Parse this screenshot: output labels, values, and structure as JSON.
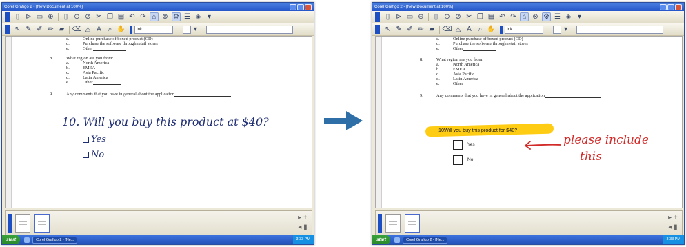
{
  "window_title": "Corel Grafigo 2 - [New Document  at 100%]",
  "toolbar_icons_top": [
    "new-doc-icon",
    "open-icon",
    "save-icon",
    "import-icon",
    "page-icon",
    "rotate-icon",
    "annotate-icon",
    "cut-icon",
    "copy-icon",
    "paste-icon",
    "undo-icon",
    "redo-icon",
    "recognize-icon",
    "link-icon",
    "settings-icon",
    "layers-icon",
    "properties-icon",
    "dropdown-icon"
  ],
  "toolbar_icons_bottom": [
    "select-icon",
    "pen-icon",
    "pen-dark-icon",
    "marker-icon",
    "highlighter-icon",
    "eraser-icon",
    "shape-icon",
    "text-icon",
    "zoom-icon",
    "pan-icon"
  ],
  "toolbar_field": "Ink",
  "document": {
    "lines_c": "c.",
    "lines_c_text": "Online purchase of boxed product (CD)",
    "lines_d": "d.",
    "lines_d_text": "Purchase the software through retail stores",
    "lines_e": "e.",
    "lines_e_text": "Other",
    "q8_num": "8.",
    "q8_text": "What region are you from:",
    "q8_a": "a.",
    "q8_a_text": "North America",
    "q8_b": "b.",
    "q8_b_text": "EMEA",
    "q8_c": "c.",
    "q8_c_text": "Asia Pacific",
    "q8_d": "d.",
    "q8_d_text": "Latin America",
    "q8_e": "e.",
    "q8_e_text": "Other",
    "q9_num": "9.",
    "q9_text": "Any comments that you have in general about the application"
  },
  "left_ink": {
    "question": "10. Will you buy this product at $40?",
    "option_yes": "Yes",
    "option_no": "No"
  },
  "right_typed": {
    "number": "10.",
    "question": "Will you buy this product for $40?",
    "option_yes": "Yes",
    "option_no": "No",
    "note_line1": "please include",
    "note_line2": "this"
  },
  "taskbar": {
    "start": "start",
    "task": "Corel Grafigo 2 - [Ne...",
    "clock": "3:33 PM"
  },
  "colors": {
    "highlight": "#ffc800",
    "ink_blue": "#1e2c72",
    "ink_red": "#d22a28",
    "arrow": "#2f6fa8"
  }
}
